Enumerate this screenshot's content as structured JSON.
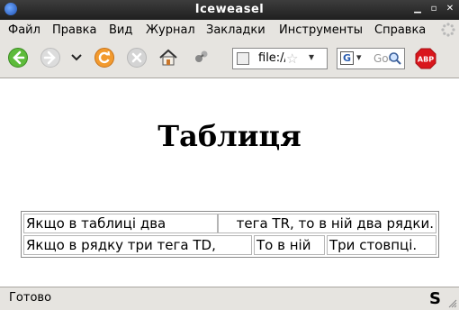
{
  "window": {
    "title": "Iceweasel"
  },
  "menu": {
    "items": [
      {
        "label": "Файл"
      },
      {
        "label": "Правка"
      },
      {
        "label": "Вид"
      },
      {
        "label": "Журнал"
      },
      {
        "label": "Закладки"
      },
      {
        "label": "Инструменты"
      },
      {
        "label": "Справка"
      }
    ]
  },
  "toolbar": {
    "url": "file:///",
    "search_placeholder": "Google",
    "search_engine_letter": "G",
    "abp_label": "ABP"
  },
  "page": {
    "heading": "Таблиця",
    "table": {
      "rows": [
        [
          "Якщо в таблиці два",
          "тега TR, то в ній два рядки."
        ],
        [
          "Якщо в рядку три тега TD,",
          "То в ній",
          "Три стовпці."
        ]
      ]
    }
  },
  "status": {
    "text": "Готово"
  },
  "colors": {
    "titlebar": "#2b2b2b",
    "chrome": "#e6e4e0",
    "content_bg": "#ffffff"
  }
}
